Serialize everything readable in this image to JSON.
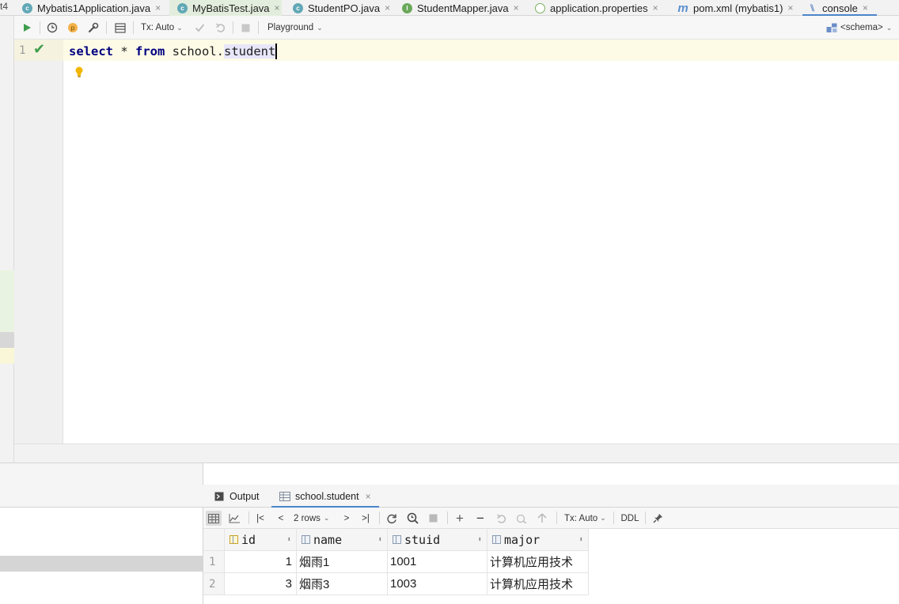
{
  "editor_tabs": {
    "left_fragment": "t4",
    "items": [
      {
        "label": "Mybatis1Application.java",
        "icon": "java-class-icon"
      },
      {
        "label": "MyBatisTest.java",
        "icon": "java-class-icon"
      },
      {
        "label": "StudentPO.java",
        "icon": "java-class-icon"
      },
      {
        "label": "StudentMapper.java",
        "icon": "java-interface-icon"
      },
      {
        "label": "application.properties",
        "icon": "properties-file-icon"
      },
      {
        "label": "pom.xml (mybatis1)",
        "icon": "maven-icon"
      },
      {
        "label": "console",
        "icon": "console-icon",
        "selected": true
      }
    ],
    "close_glyph": "×"
  },
  "editor_toolbar": {
    "tx_mode": "Tx: Auto",
    "playground": "Playground",
    "schema": "<schema>",
    "chevron": "v"
  },
  "editor": {
    "line_number": "1",
    "sql": {
      "kw1": "select",
      "star": " * ",
      "kw2": "from",
      "space": " ",
      "schema_part": "school.",
      "table_part": "student"
    }
  },
  "results": {
    "tabs": [
      {
        "label": "Output"
      },
      {
        "label": "school.student",
        "selected": true
      }
    ],
    "toolbar": {
      "rows_label": "2 rows",
      "tx_mode": "Tx: Auto",
      "ddl": "DDL"
    },
    "columns": [
      "id",
      "name",
      "stuid",
      "major"
    ],
    "rows": [
      {
        "n": "1",
        "id": "1",
        "name": "烟雨1",
        "stuid": "1001",
        "major": "计算机应用技术"
      },
      {
        "n": "2",
        "id": "3",
        "name": "烟雨3",
        "stuid": "1003",
        "major": "计算机应用技术"
      }
    ]
  },
  "colors": {
    "accent": "#4a86c8",
    "keyword": "#000080",
    "run_green": "#3f9e4e",
    "current_line": "#fdfbe6"
  }
}
